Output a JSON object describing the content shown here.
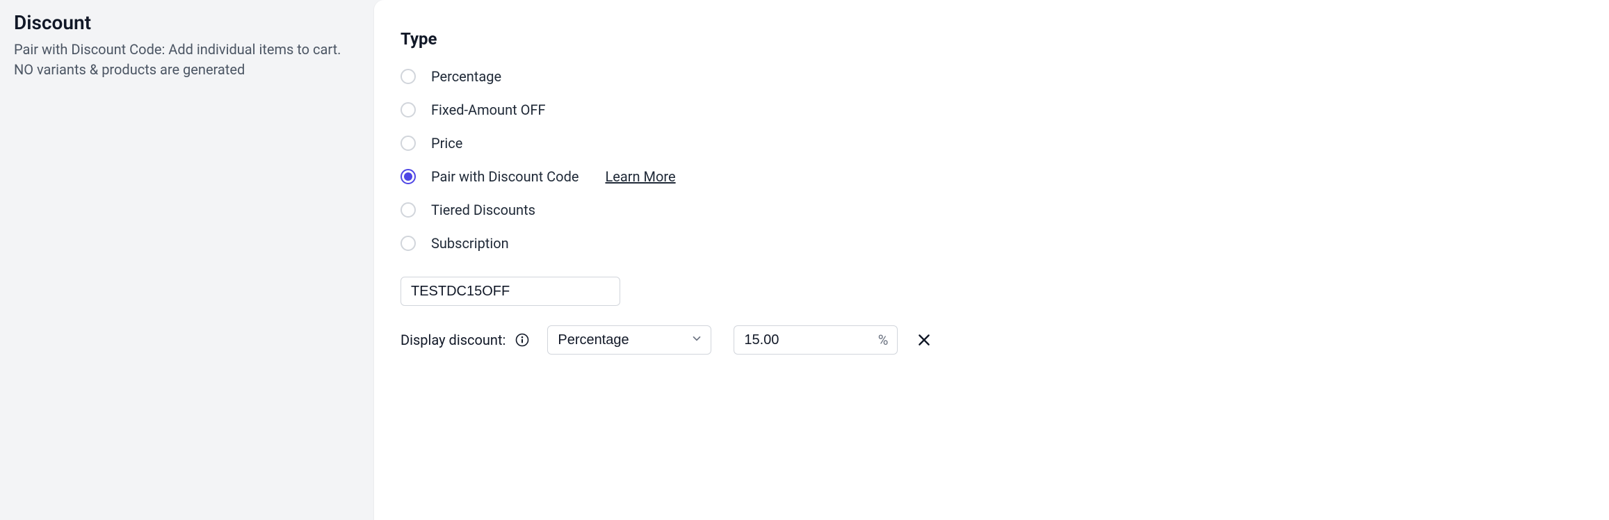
{
  "left": {
    "title": "Discount",
    "description": "Pair with Discount Code: Add individual items to cart. NO variants & products are generated"
  },
  "type": {
    "title": "Type",
    "options": [
      {
        "label": "Percentage",
        "selected": false
      },
      {
        "label": "Fixed-Amount OFF",
        "selected": false
      },
      {
        "label": "Price",
        "selected": false
      },
      {
        "label": "Pair with Discount Code",
        "selected": true,
        "learn_more": "Learn More"
      },
      {
        "label": "Tiered Discounts",
        "selected": false
      },
      {
        "label": "Subscription",
        "selected": false
      }
    ]
  },
  "code_input": {
    "value": "TESTDC15OFF"
  },
  "display": {
    "label": "Display discount:",
    "select_value": "Percentage",
    "value": "15.00",
    "suffix": "%"
  }
}
